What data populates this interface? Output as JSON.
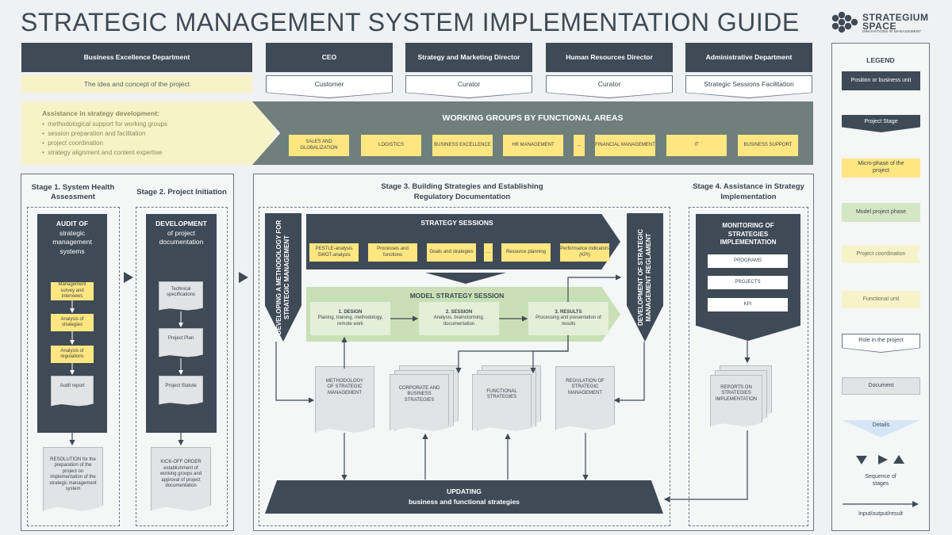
{
  "title": "STRATEGIC MANAGEMENT SYSTEM IMPLEMENTATION GUIDE",
  "logo": {
    "name": "STRATEGIUM SPACE",
    "line1": "STRATEGIUM",
    "line2": "SPACE",
    "tagline": "INNOVATIONS IN MANAGEMENT"
  },
  "positions": [
    {
      "label": "Business Excellence Department",
      "role": "The idea and concept of the project"
    },
    {
      "label": "CEO",
      "role": "Customer"
    },
    {
      "label": "Strategy and Marketing Director",
      "role": "Curator"
    },
    {
      "label": "Human Resources Director",
      "role": "Curator"
    },
    {
      "label": "Administrative Department",
      "role": "Strategic Sessions Facilitation"
    }
  ],
  "assistance": {
    "title": "Assistance in strategy development:",
    "items": [
      "methodological support for working groups",
      "session preparation and facilitation",
      "project coordination",
      "strategy alignment and content expertise"
    ]
  },
  "working_groups": {
    "title": "WORKING GROUPS BY FUNCTIONAL AREAS",
    "items": [
      "SALES AND GLOBALIZATION",
      "LOGISTICS",
      "BUSINESS EXCELLENCE",
      "HR MANAGEMENT",
      "...",
      "FINANCIAL MANAGEMENT",
      "IT",
      "BUSINESS SUPPORT"
    ]
  },
  "stage1": {
    "title": "Stage 1. System Health Assessment",
    "audit_title": "AUDIT OF",
    "audit_sub": "strategic management systems",
    "steps": [
      "Management survey and interviews",
      "Analysis of strategies",
      "Analysis of regulations"
    ],
    "doc": "Audit report",
    "result": "RESOLUTION for the preparation of the project on implementation of the strategic management system"
  },
  "stage2": {
    "title": "Stage 2. Project Initiation",
    "dev_title": "DEVELOPMENT",
    "dev_sub": "of project documentation",
    "docs": [
      "Technical specifications",
      "Project Plan",
      "Project Statute"
    ],
    "result": "KICK-OFF ORDER establishment of working groups and approval of project documentation"
  },
  "stage3": {
    "title": "Stage 3. Building Strategies and Establishing Regulatory Documentation",
    "methodology": "DEVELOPING A METHODOLOGY FOR STRATEGIC MANAGEMENT",
    "sessions_title": "STRATEGY SESSIONS",
    "sessions": [
      "PESTLE-analysis SWOT-analysis",
      "Processes and functions",
      "Goals and strategies",
      "...",
      "Resource planning",
      "Performance indicators (KPI)"
    ],
    "model_title": "MODEL STRATEGY SESSION",
    "model_steps": [
      {
        "title": "1. DESIGN",
        "text": "Planing, training, methodology, remote work"
      },
      {
        "title": "2. SESSION",
        "text": "Analysis, brainstorming, documentation"
      },
      {
        "title": "3. RESULTS",
        "text": "Processing and presentation of results"
      }
    ],
    "reglament": "DEVELOPMENT OF STRATEGIC MANAGEMENT REGLAMENT",
    "docs": [
      "METHODOLOGY OF STRATEGIC MANAGEMENT",
      "CORPORATE AND BUSINESS STRATEGIES",
      "FUNCTIONAL STRATEGIES",
      "REGULATION OF STRATEGIC MANAGEMENT"
    ],
    "updating_title": "UPDATING",
    "updating_sub": "business and functional strategies"
  },
  "stage4": {
    "title": "Stage 4. Assistance in Strategy Implementation",
    "monitor": "MONITORING OF STRATEGIES IMPLEMENTATION",
    "items": [
      "PROGRAMS",
      "PROJECTS",
      "KPI"
    ],
    "doc": "REPORTS ON STRATEGIES IMPLEMENTATION"
  },
  "legend": {
    "title": "LEGEND",
    "position": "Position or business unit",
    "stage": "Project Stage",
    "micro": "Micro-phase of the project",
    "model": "Model project phase",
    "coord": "Project coordination",
    "func": "Functional unit",
    "role": "Role in the project",
    "document": "Document",
    "details": "Details",
    "sequence": "Sequence of stages",
    "io": "Input/output/result"
  },
  "colors": {
    "dark": "#3e4a56",
    "yellow": "#ffe680",
    "green": "#d4e7c5",
    "light_yellow": "#f7f3c8",
    "slate": "#6e7f7c"
  }
}
